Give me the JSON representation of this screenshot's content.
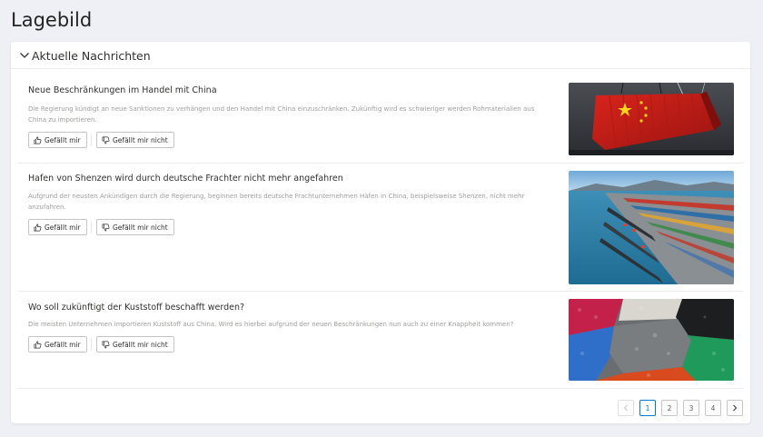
{
  "page": {
    "title": "Lagebild"
  },
  "section": {
    "title": "Aktuelle Nachrichten"
  },
  "news": [
    {
      "title": "Neue Beschränkungen im Handel mit China",
      "description": "Die Regierung kündigt an neue Sanktionen zu verhängen und den Handel mit China einzuschränken. Zukünftig wird es schwieriger werden Rohmaterialien aus China zu importieren.",
      "like_label": "Gefällt mir",
      "dislike_label": "Gefällt mir nicht",
      "image_icon": "china-container-image"
    },
    {
      "title": "Hafen von Shenzen wird durch deutsche Frachter nicht mehr angefahren",
      "description": "Aufgrund der neusten Ankündigen durch die Regierung, beginnen bereits deutsche Frachtunternehmen Häfen in China, beispielsweise Shenzen, nicht mehr anzufahren.",
      "like_label": "Gefällt mir",
      "dislike_label": "Gefällt mir nicht",
      "image_icon": "container-port-image"
    },
    {
      "title": "Wo soll zukünftigt der Kuststoff beschafft werden?",
      "description": "Die meisten Unternehmen importieren Kuststoff aus China. Wird es hierbei aufgrund der neuen Beschränkungen nun auch zu einer Knappheit kommen?",
      "like_label": "Gefällt mir",
      "dislike_label": "Gefällt mir nicht",
      "image_icon": "plastic-granulate-image"
    }
  ],
  "pagination": {
    "pages": [
      "1",
      "2",
      "3",
      "4"
    ],
    "current": "1"
  },
  "colors": {
    "accent": "#0078d4",
    "background": "#eef0f5",
    "card": "#ffffff"
  }
}
